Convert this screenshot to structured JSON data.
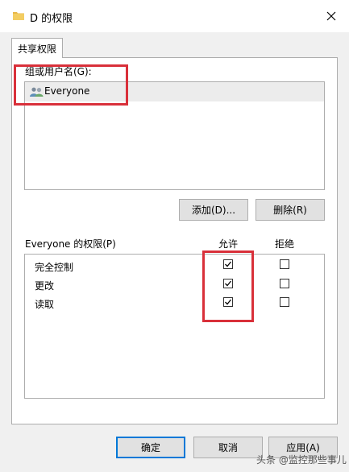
{
  "window": {
    "title": "D 的权限",
    "icon": "folder-icon",
    "close_icon": "close-icon"
  },
  "tabs": [
    {
      "label": "共享权限",
      "selected": true
    }
  ],
  "groups": {
    "label": "组或用户名(G):",
    "items": [
      {
        "name": "Everyone",
        "icon": "users-icon",
        "selected": true
      }
    ]
  },
  "group_buttons": {
    "add": "添加(D)...",
    "remove": "删除(R)"
  },
  "permissions": {
    "label": "Everyone 的权限(P)",
    "allow_header": "允许",
    "deny_header": "拒绝",
    "rows": [
      {
        "name": "完全控制",
        "allow": true,
        "deny": false
      },
      {
        "name": "更改",
        "allow": true,
        "deny": false
      },
      {
        "name": "读取",
        "allow": true,
        "deny": false
      }
    ]
  },
  "footer": {
    "ok": "确定",
    "cancel": "取消",
    "apply": "应用(A)"
  },
  "watermark": "头条 @监控那些事儿",
  "colors": {
    "highlight": "#d9303a",
    "accent": "#0078d7",
    "folder": "#e8b84a"
  }
}
